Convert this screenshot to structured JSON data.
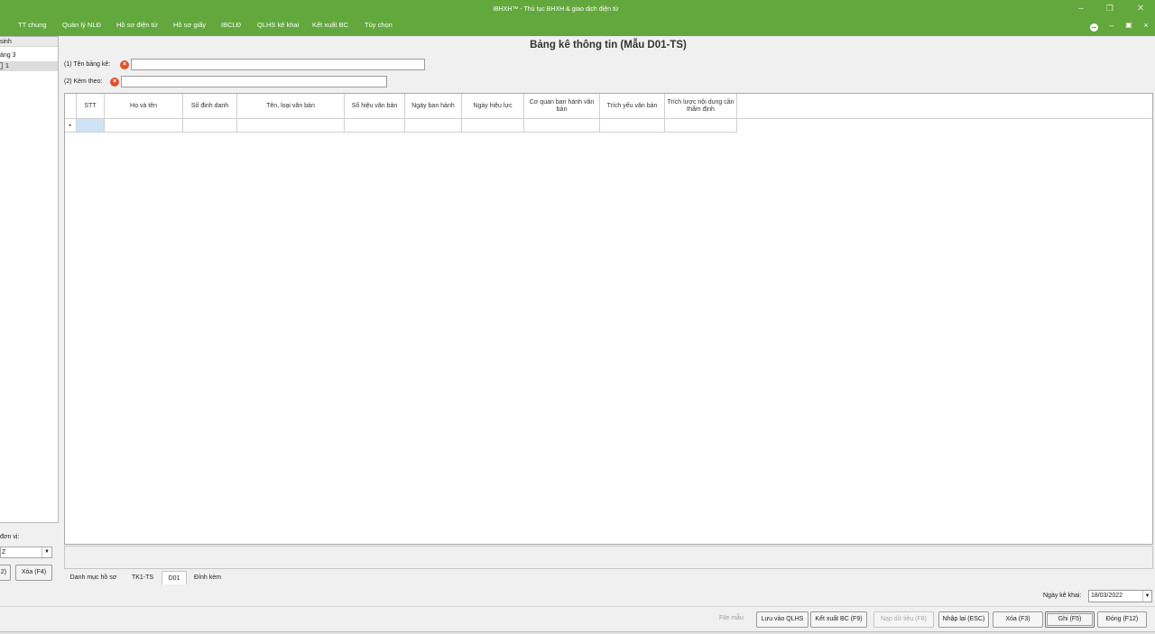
{
  "window": {
    "title": "iBHXH™ - Thủ tục BHXH & giao dịch điện tử"
  },
  "menu": [
    "TT chung",
    "Quản lý NLĐ",
    "Hồ sơ điện tử",
    "Hồ sơ giấy",
    "IBCLĐ",
    "QLHS kê khai",
    "Kết xuất BC",
    "Tùy chọn"
  ],
  "left_panel": {
    "tree": [
      "sinh",
      "áng 3",
      "1"
    ],
    "unit_label": "đơn vị:",
    "unit_value": "Z",
    "buttons": [
      "2)",
      "Xóa (F4)"
    ]
  },
  "form": {
    "title": "Bảng kê thông tin (Mẫu D01-TS)",
    "field1_label": "(1) Tên bảng kê:",
    "field1_value": "",
    "field2_label": "(2) Kèm theo:",
    "field2_value": ""
  },
  "grid": {
    "columns": [
      "STT",
      "Họ và tên",
      "Số định danh",
      "Tên, loại văn bản",
      "Số hiệu văn bản",
      "Ngày ban hành",
      "Ngày hiệu lực",
      "Cơ quan ban hành văn bản",
      "Trích yếu văn bản",
      "Trích lược nội dung cần thẩm định"
    ],
    "row_indicator": "▸"
  },
  "tabs": [
    "Danh mục hồ sơ",
    "TK1-TS",
    "D01",
    "Đính kèm"
  ],
  "active_tab": "D01",
  "footer": {
    "date_label": "Ngày kê khai:",
    "date_value": "18/03/2022",
    "file_mau": "File mẫu",
    "buttons": [
      "Lưu vào QLHS",
      "Kết xuất BC (F9)",
      "Nạp dữ liệu (F8)",
      "Nhập lại (ESC)",
      "Xóa (F3)",
      "Ghi (F5)",
      "Đóng (F12)"
    ]
  },
  "colors": {
    "titlebar": "#62a83c",
    "error_icon": "#e0522e"
  }
}
